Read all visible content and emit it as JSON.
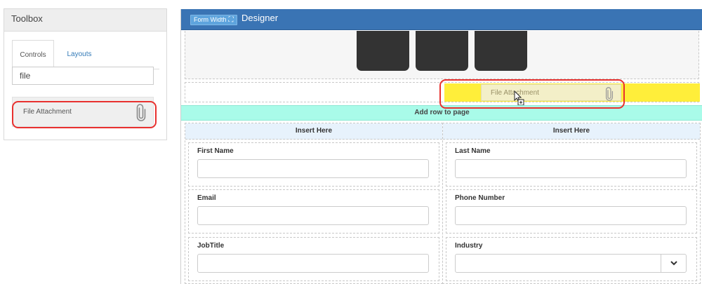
{
  "toolbox": {
    "title": "Toolbox",
    "tabs": [
      {
        "label": "Controls",
        "active": true
      },
      {
        "label": "Layouts",
        "active": false
      }
    ],
    "search": {
      "value": "file",
      "placeholder": ""
    },
    "items": [
      {
        "label": "File Attachment",
        "icon": "paperclip-icon"
      }
    ]
  },
  "designer": {
    "form_width_label": "Form Width",
    "form_width_icon": "expand-icon",
    "title": "Designer",
    "drag_ghost": {
      "label": "File Attachment",
      "icon": "paperclip-icon"
    },
    "add_row_label": "Add row to page",
    "columns": [
      {
        "header": "Insert Here",
        "fields": [
          {
            "label": "First Name",
            "value": "",
            "type": "text"
          },
          {
            "label": "Email",
            "value": "",
            "type": "text"
          },
          {
            "label": "JobTitle",
            "value": "",
            "type": "text"
          }
        ]
      },
      {
        "header": "Insert Here",
        "fields": [
          {
            "label": "Last Name",
            "value": "",
            "type": "text"
          },
          {
            "label": "Phone Number",
            "value": "",
            "type": "text"
          },
          {
            "label": "Industry",
            "value": "",
            "type": "select"
          }
        ]
      }
    ]
  },
  "colors": {
    "header_blue": "#3a74b4",
    "form_width_button": "#5ea4dd",
    "drop_zone_yellow": "#ffee3a",
    "add_row_mint": "#a9fbe9",
    "column_header": "#e7f2fc",
    "annotation_red": "#e8312f"
  }
}
